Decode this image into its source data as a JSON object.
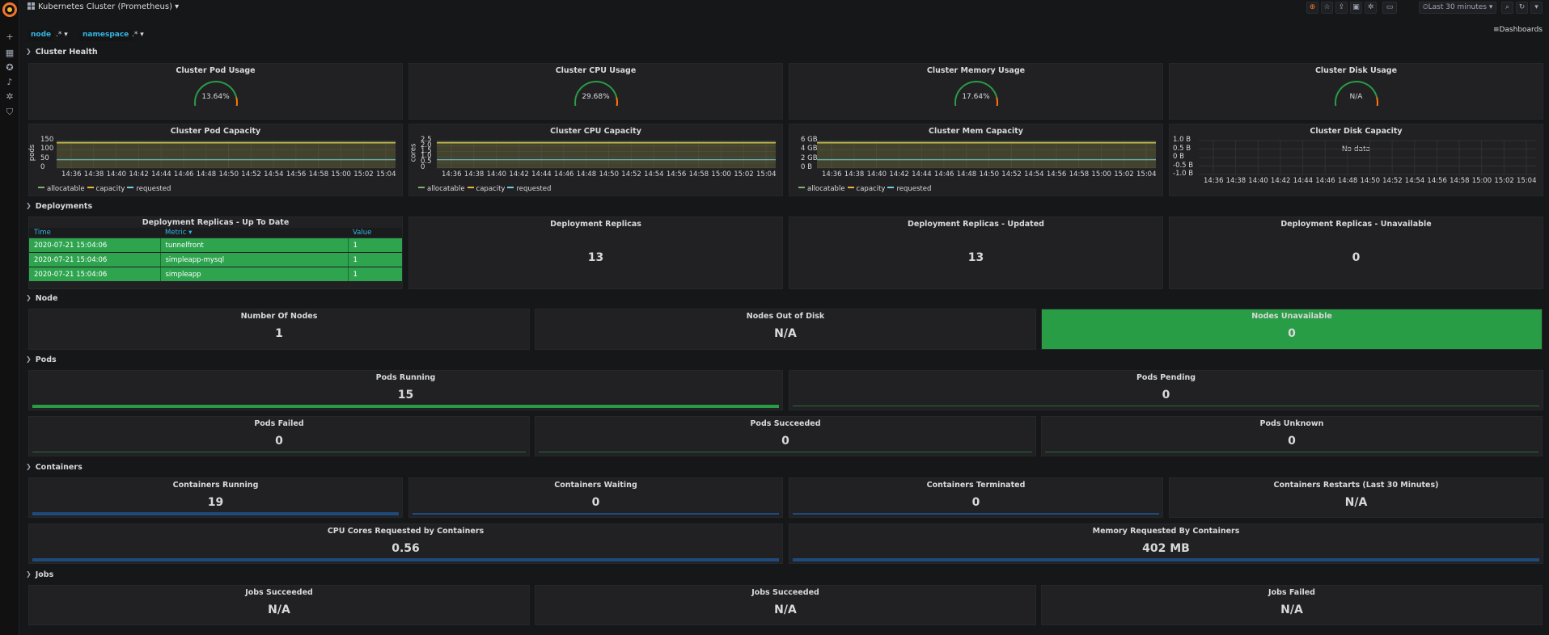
{
  "topbar": {
    "dashboard_title": "Kubernetes Cluster (Prometheus) ▾",
    "timepicker": "⏲Last 30 minutes ▾",
    "dashboards_link": "≡Dashboards"
  },
  "variables": [
    {
      "label": "node",
      "value": ".* ▾"
    },
    {
      "label": "namespace",
      "value": ".* ▾"
    }
  ],
  "rows": {
    "cluster_health": "Cluster Health",
    "deployments": "Deployments",
    "node": "Node",
    "pods": "Pods",
    "containers": "Containers",
    "jobs": "Jobs"
  },
  "gauges": [
    {
      "title": "Cluster Pod Usage",
      "value": "13.64%",
      "fraction": 0.1364
    },
    {
      "title": "Cluster CPU Usage",
      "value": "29.68%",
      "fraction": 0.2968
    },
    {
      "title": "Cluster Memory Usage",
      "value": "17.64%",
      "fraction": 0.1764
    },
    {
      "title": "Cluster Disk Usage",
      "value": "N/A",
      "fraction": 0
    }
  ],
  "graphs": [
    {
      "title": "Cluster Pod Capacity",
      "ylabel": "pods",
      "yticks": [
        "150",
        "100",
        "50",
        "0"
      ]
    },
    {
      "title": "Cluster CPU Capacity",
      "ylabel": "cores",
      "yticks": [
        "2.5",
        "2.0",
        "1.5",
        "1.0",
        "0.5",
        "0"
      ]
    },
    {
      "title": "Cluster Mem Capacity",
      "ylabel": "",
      "yticks": [
        "6 GB",
        "4 GB",
        "2 GB",
        "0 B"
      ]
    },
    {
      "title": "Cluster Disk Capacity",
      "ylabel": "",
      "yticks": [
        "1.0 B",
        "0.5 B",
        "0 B",
        "-0.5 B",
        "-1.0 B"
      ],
      "nodata": "No data"
    }
  ],
  "xticks": [
    "14:36",
    "14:38",
    "14:40",
    "14:42",
    "14:44",
    "14:46",
    "14:48",
    "14:50",
    "14:52",
    "14:54",
    "14:56",
    "14:58",
    "15:00",
    "15:02",
    "15:04"
  ],
  "legend": [
    {
      "name": "allocatable",
      "color": "#7eb26d"
    },
    {
      "name": "capacity",
      "color": "#eab839"
    },
    {
      "name": "requested",
      "color": "#6ed0e0"
    }
  ],
  "deployment_table": {
    "title": "Deployment Replicas - Up To Date",
    "columns": [
      "Time",
      "Metric ▾",
      "Value"
    ],
    "rows": [
      [
        "2020-07-21 15:04:06",
        "tunnelfront",
        "1"
      ],
      [
        "2020-07-21 15:04:06",
        "simpleapp-mysql",
        "1"
      ],
      [
        "2020-07-21 15:04:06",
        "simpleapp",
        "1"
      ]
    ]
  },
  "stats": {
    "deploy_replicas": {
      "title": "Deployment Replicas",
      "value": "13"
    },
    "deploy_updated": {
      "title": "Deployment Replicas - Updated",
      "value": "13"
    },
    "deploy_unavailable": {
      "title": "Deployment Replicas - Unavailable",
      "value": "0"
    },
    "num_nodes": {
      "title": "Number Of Nodes",
      "value": "1"
    },
    "nodes_out_of_disk": {
      "title": "Nodes Out of Disk",
      "value": "N/A"
    },
    "nodes_unavailable": {
      "title": "Nodes Unavailable",
      "value": "0"
    },
    "pods_running": {
      "title": "Pods Running",
      "value": "15"
    },
    "pods_pending": {
      "title": "Pods Pending",
      "value": "0"
    },
    "pods_failed": {
      "title": "Pods Failed",
      "value": "0"
    },
    "pods_succeeded": {
      "title": "Pods Succeeded",
      "value": "0"
    },
    "pods_unknown": {
      "title": "Pods Unknown",
      "value": "0"
    },
    "containers_running": {
      "title": "Containers Running",
      "value": "19"
    },
    "containers_waiting": {
      "title": "Containers Waiting",
      "value": "0"
    },
    "containers_terminated": {
      "title": "Containers Terminated",
      "value": "0"
    },
    "containers_restarts": {
      "title": "Containers Restarts (Last 30 Minutes)",
      "value": "N/A"
    },
    "cpu_requested": {
      "title": "CPU Cores Requested by Containers",
      "value": "0.56"
    },
    "mem_requested": {
      "title": "Memory Requested By Containers",
      "value": "402 MB"
    },
    "jobs_succeeded_1": {
      "title": "Jobs Succeeded",
      "value": "N/A"
    },
    "jobs_succeeded_2": {
      "title": "Jobs Succeeded",
      "value": "N/A"
    },
    "jobs_failed": {
      "title": "Jobs Failed",
      "value": "N/A"
    }
  },
  "colors": {
    "ok_green": "#299c46",
    "gauge_red": "#d44a3a",
    "gauge_orange": "#ff780a",
    "link_blue": "#33b5e5",
    "brand_orange": "#f0762c"
  }
}
